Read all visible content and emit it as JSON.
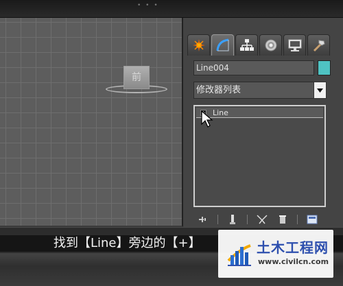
{
  "viewport": {
    "viewcube_face_label": "前"
  },
  "command_panel": {
    "tabs": [
      {
        "name": "create",
        "icon": "create-star-icon",
        "active": false
      },
      {
        "name": "modify",
        "icon": "modify-arc-icon",
        "active": true
      },
      {
        "name": "hierarchy",
        "icon": "hierarchy-icon",
        "active": false
      },
      {
        "name": "motion",
        "icon": "motion-icon",
        "active": false
      },
      {
        "name": "display",
        "icon": "display-monitor-icon",
        "active": false
      },
      {
        "name": "utilities",
        "icon": "hammer-icon",
        "active": false
      }
    ],
    "object_name": "Line004",
    "object_color": "#4fc3c3",
    "modifier_list_label": "修改器列表",
    "stack": [
      {
        "label": "Line",
        "expand_symbol": "+"
      }
    ]
  },
  "subtitle": "找到【Line】旁边的【+】",
  "watermark": {
    "title": "土木工程网",
    "url": "www.civilcn.com"
  }
}
